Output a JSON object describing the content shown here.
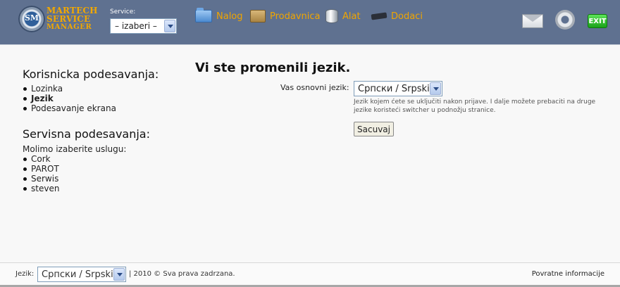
{
  "header": {
    "logo": {
      "badge": "SM",
      "line1": "MARTECH",
      "line2": "SERVICE",
      "line3": "MANAGER"
    },
    "service": {
      "label": "Service:",
      "selected": "– izaberi –"
    },
    "nav": [
      {
        "label": "Nalog",
        "icon": "folder-icon"
      },
      {
        "label": "Prodavnica",
        "icon": "shop-icon"
      },
      {
        "label": "Alat",
        "icon": "database-icon"
      },
      {
        "label": "Dodaci",
        "icon": "plug-icon"
      }
    ],
    "right_icons": [
      "mail-icon",
      "gear-icon",
      "exit-icon"
    ],
    "exit_label": "EXIT"
  },
  "sidebar": {
    "user_settings_title": "Korisnicka podesavanja:",
    "user_settings_items": [
      "Lozinka",
      "Jezik",
      "Podesavanje ekrana"
    ],
    "service_settings_title": "Servisna podesavanja:",
    "service_prompt": "Molimo izaberite uslugu:",
    "services": [
      "Cork",
      "PAROT",
      "Serwis",
      "steven"
    ]
  },
  "main": {
    "title": "Vi ste promenili jezik.",
    "lang_label": "Vas osnovni jezik:",
    "lang_selected": "Српски / Srpski",
    "hint": "Jezik kojem ćete se uključiti nakon prijave. I dalje možete prebaciti na druge jezike koristeći switcher u podnožju stranice.",
    "save_label": "Sacuvaj"
  },
  "footer": {
    "lang_label": "Jezik:",
    "lang_selected": "Српски / Srpski",
    "copyright": "| 2010 © Sva prava zadrzana.",
    "feedback_link": "Povratne informacije"
  },
  "colors": {
    "header_bg": "#5f7190",
    "accent": "#f0a500"
  }
}
